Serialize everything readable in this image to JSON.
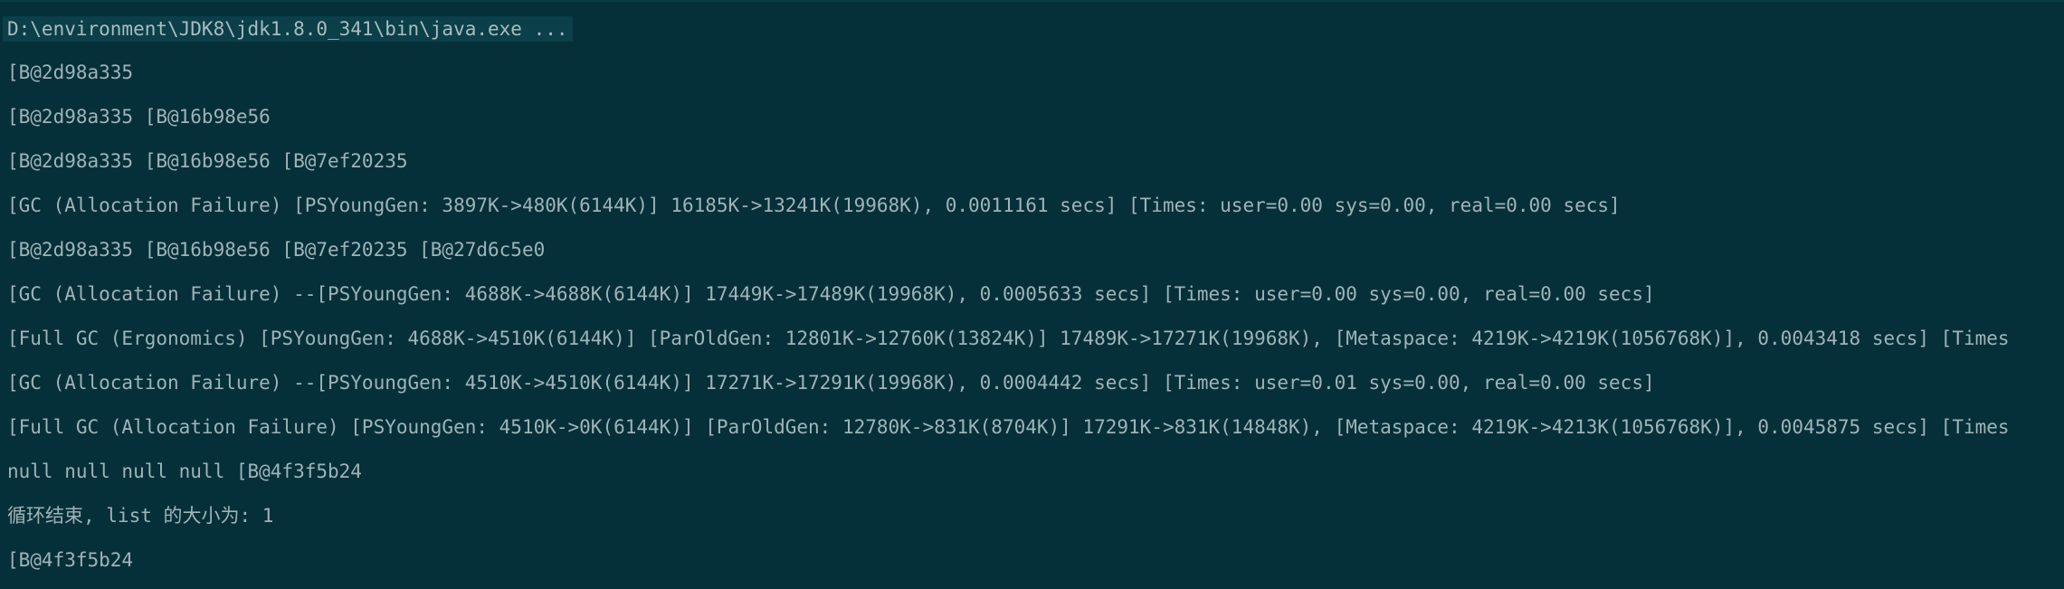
{
  "console": {
    "command": "D:\\environment\\JDK8\\jdk1.8.0_341\\bin\\java.exe ...",
    "lines": [
      "[B@2d98a335",
      "[B@2d98a335 [B@16b98e56",
      "[B@2d98a335 [B@16b98e56 [B@7ef20235",
      "[GC (Allocation Failure) [PSYoungGen: 3897K->480K(6144K)] 16185K->13241K(19968K), 0.0011161 secs] [Times: user=0.00 sys=0.00, real=0.00 secs]",
      "[B@2d98a335 [B@16b98e56 [B@7ef20235 [B@27d6c5e0",
      "[GC (Allocation Failure) --[PSYoungGen: 4688K->4688K(6144K)] 17449K->17489K(19968K), 0.0005633 secs] [Times: user=0.00 sys=0.00, real=0.00 secs]",
      "[Full GC (Ergonomics) [PSYoungGen: 4688K->4510K(6144K)] [ParOldGen: 12801K->12760K(13824K)] 17489K->17271K(19968K), [Metaspace: 4219K->4219K(1056768K)], 0.0043418 secs] [Times",
      "[GC (Allocation Failure) --[PSYoungGen: 4510K->4510K(6144K)] 17271K->17291K(19968K), 0.0004442 secs] [Times: user=0.01 sys=0.00, real=0.00 secs]",
      "[Full GC (Allocation Failure) [PSYoungGen: 4510K->0K(6144K)] [ParOldGen: 12780K->831K(8704K)] 17291K->831K(14848K), [Metaspace: 4219K->4213K(1056768K)], 0.0045875 secs] [Times",
      "null null null null [B@4f3f5b24",
      "循环结束, list 的大小为: 1",
      "[B@4f3f5b24"
    ]
  },
  "colors": {
    "background": "#05303a",
    "text": "#9fb3b8",
    "command_highlight": "#0b3f4a"
  }
}
